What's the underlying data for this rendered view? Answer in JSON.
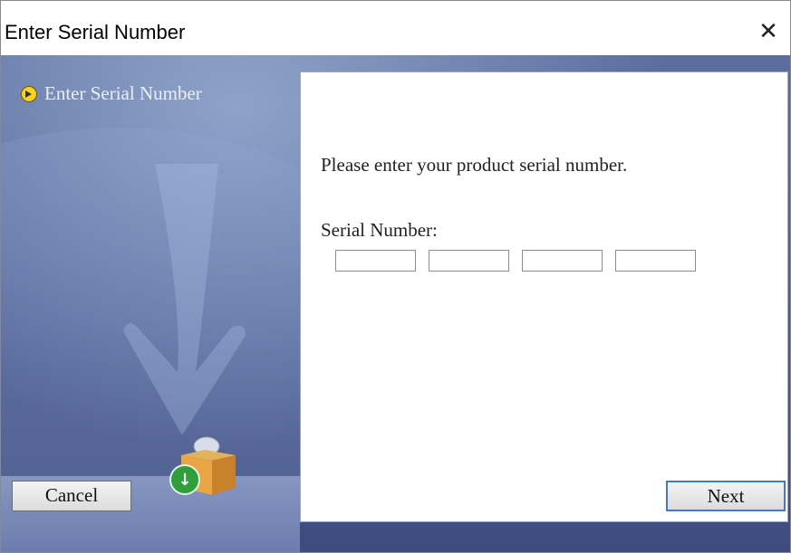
{
  "window": {
    "title": "Enter Serial Number",
    "close_glyph": "✕"
  },
  "sidebar": {
    "steps": [
      {
        "label": "Enter Serial Number",
        "icon": "arrow-bullet-icon",
        "active": true
      }
    ]
  },
  "main": {
    "prompt": "Please enter your product serial number.",
    "serial_label": "Serial Number:",
    "serial_fields": [
      {
        "value": "",
        "placeholder": ""
      },
      {
        "value": "",
        "placeholder": ""
      },
      {
        "value": "",
        "placeholder": ""
      },
      {
        "value": "",
        "placeholder": ""
      }
    ]
  },
  "footer": {
    "cancel_label": "Cancel",
    "next_label": "Next"
  },
  "colors": {
    "panel_blue": "#4a5b8e",
    "bullet_yellow": "#f7d51e",
    "download_green": "#2e9f3a",
    "default_button_border": "#3d7bd6"
  }
}
